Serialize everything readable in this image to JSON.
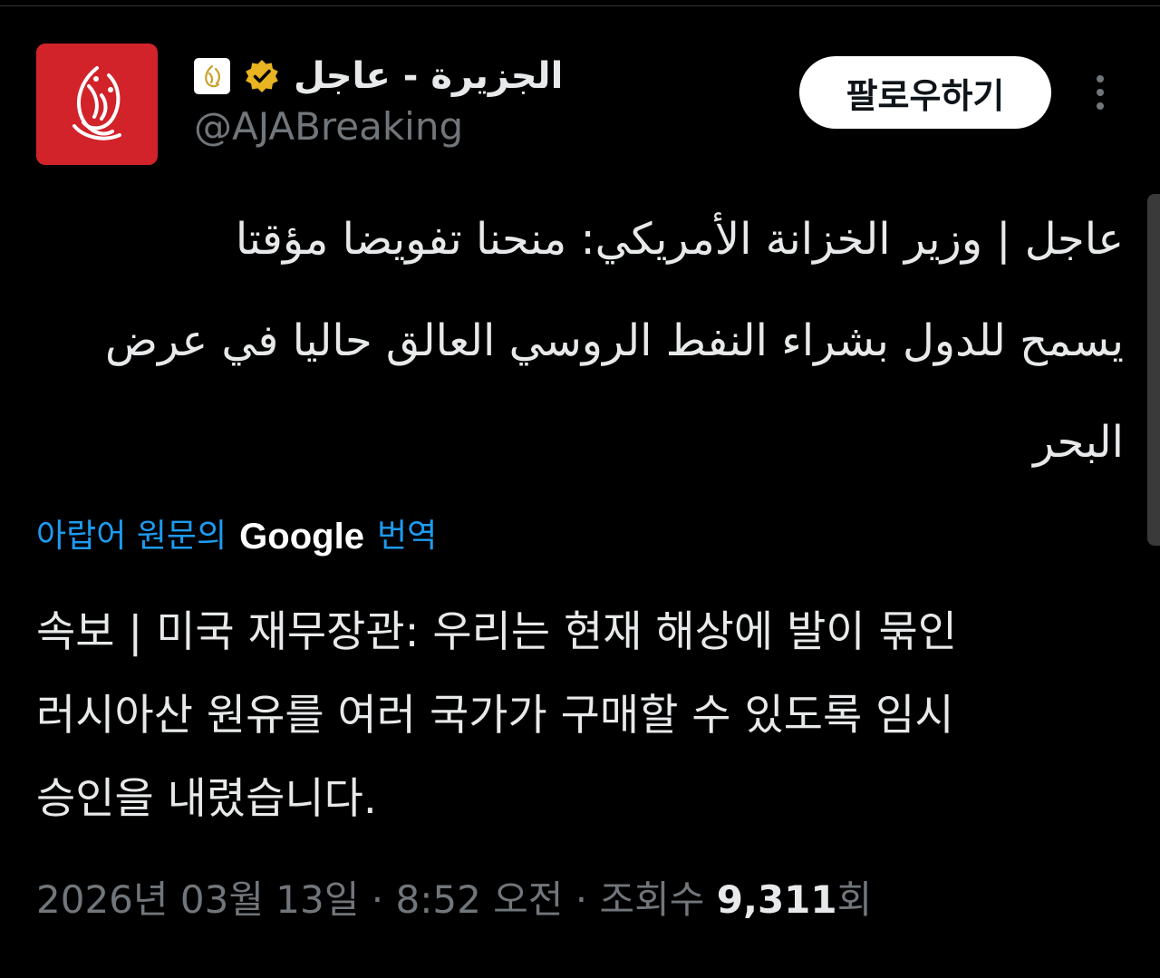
{
  "author": {
    "display_name": "الجزيرة - عاجل",
    "handle": "@AJABreaking",
    "avatar_icon": "aljazeera-logo-icon",
    "avatar_color": "#d2232a",
    "affiliation_icon": "aljazeera-affiliate-badge-icon",
    "verified_icon": "gold-verified-badge-icon",
    "verified_color": "#e8b422"
  },
  "actions": {
    "follow_label": "팔로우하기",
    "more_icon": "more-vertical-icon"
  },
  "tweet": {
    "text_arabic": "عاجل | وزير الخزانة الأمريكي: منحنا تفويضا مؤقتا\nيسمح للدول بشراء النفط الروسي العالق حاليا في عرض\nالبحر",
    "translate_prefix": "아랍어 원문의",
    "translate_brand": "Google",
    "translate_suffix": "번역",
    "text_korean": "속보 | 미국 재무장관: 우리는 현재 해상에 발이 묶인\n러시아산 원유를 여러 국가가 구매할 수 있도록 임시\n승인을 내렸습니다."
  },
  "meta": {
    "date": "2026년 03월 13일",
    "separator": " · ",
    "time": "8:52 오전",
    "views_label": "조회수 ",
    "views_count": "9,311",
    "views_suffix": "회"
  },
  "colors": {
    "background": "#000000",
    "text_primary": "#e7e9ea",
    "text_secondary": "#71767b",
    "link": "#1d9bf0",
    "button_bg": "#ffffff"
  }
}
